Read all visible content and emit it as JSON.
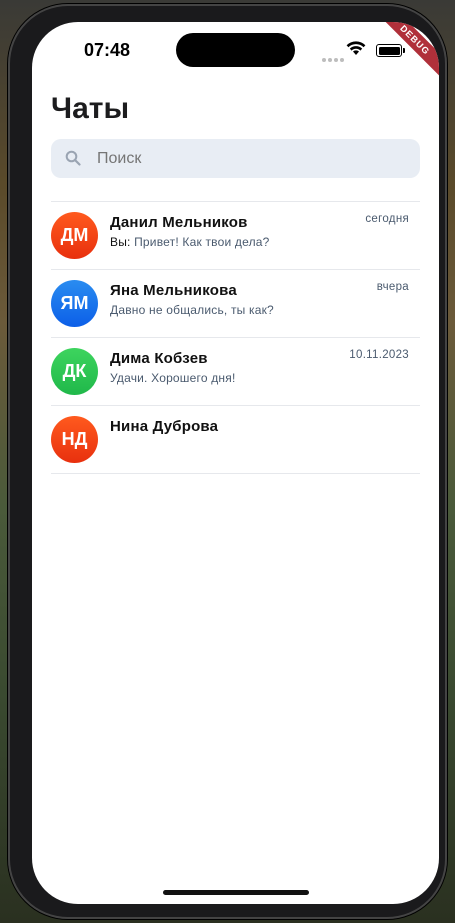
{
  "status": {
    "time": "07:48"
  },
  "debug_label": "DEBUG",
  "header": {
    "title": "Чаты"
  },
  "search": {
    "placeholder": "Поиск",
    "icon": "search-icon"
  },
  "chats": [
    {
      "initials": "ДМ",
      "name": "Данил Мельников",
      "prefix": "Вы: ",
      "message": "Привет! Как твои дела?",
      "time": "сегодня",
      "color_top": "#ff5a1e",
      "color_bottom": "#e8300e"
    },
    {
      "initials": "ЯМ",
      "name": "Яна Мельникова",
      "prefix": "",
      "message": "Давно не общались, ты как?",
      "time": "вчера",
      "color_top": "#2a8cf0",
      "color_bottom": "#0c5fe8"
    },
    {
      "initials": "ДК",
      "name": "Дима Кобзев",
      "prefix": "",
      "message": "Удачи. Хорошего дня!",
      "time": "10.11.2023",
      "color_top": "#3dd45e",
      "color_bottom": "#20b84a"
    },
    {
      "initials": "НД",
      "name": "Нина Дуброва",
      "prefix": "",
      "message": "",
      "time": "",
      "color_top": "#ff5a1e",
      "color_bottom": "#e8300e"
    }
  ]
}
